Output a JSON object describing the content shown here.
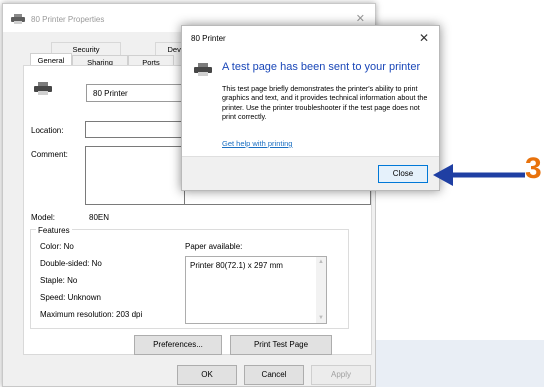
{
  "window": {
    "title": "80 Printer Properties",
    "tabs_back": [
      "Security",
      "Devi"
    ],
    "tabs_front": [
      "General",
      "Sharing",
      "Ports"
    ],
    "printer_name": "80 Printer",
    "location_label": "Location:",
    "comment_label": "Comment:",
    "model_label": "Model:",
    "model_value": "80EN",
    "features_title": "Features",
    "features": [
      "Color: No",
      "Double-sided: No",
      "Staple: No",
      "Speed: Unknown",
      "Maximum resolution: 203 dpi"
    ],
    "paper_label": "Paper available:",
    "paper_items": [
      "Printer 80(72.1) x 297 mm"
    ],
    "preferences_button": "Preferences...",
    "print_test_button": "Print Test Page",
    "ok_button": "OK",
    "cancel_button": "Cancel",
    "apply_button": "Apply"
  },
  "dialog": {
    "title": "80 Printer",
    "heading": "A test page has been sent to your printer",
    "body": "This test page briefly demonstrates the printer's ability to print graphics and text, and it provides technical information about the printer. Use the printer troubleshooter if the test page does not print correctly.",
    "link": "Get help with printing",
    "close_button": "Close"
  },
  "annotation": {
    "step_number": "3",
    "arrow_color": "#1f3fa3",
    "number_color": "#e8720c"
  },
  "icons": {
    "printer": "printer-icon",
    "close": "close-icon"
  }
}
